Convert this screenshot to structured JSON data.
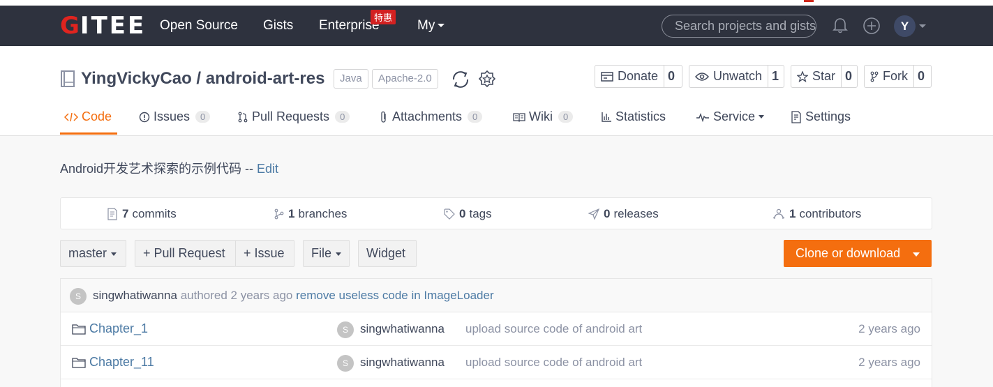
{
  "nav": {
    "logo_g": "G",
    "logo_rest": "ITEE",
    "links": [
      "Open Source",
      "Gists",
      "Enterprise",
      "My"
    ],
    "enterprise_badge": "特惠",
    "search_placeholder": "Search projects and gists",
    "avatar_letter": "Y"
  },
  "repo": {
    "owner_repo": "YingVickyCao / android-art-res",
    "language": "Java",
    "license": "Apache-2.0",
    "actions": {
      "donate": {
        "label": "Donate",
        "count": "0"
      },
      "unwatch": {
        "label": "Unwatch",
        "count": "1"
      },
      "star": {
        "label": "Star",
        "count": "0"
      },
      "fork": {
        "label": "Fork",
        "count": "0"
      }
    }
  },
  "tabs": [
    {
      "label": "Code"
    },
    {
      "label": "Issues",
      "count": "0"
    },
    {
      "label": "Pull Requests",
      "count": "0"
    },
    {
      "label": "Attachments",
      "count": "0"
    },
    {
      "label": "Wiki",
      "count": "0"
    },
    {
      "label": "Statistics"
    },
    {
      "label": "Service"
    },
    {
      "label": "Settings"
    }
  ],
  "description": {
    "text": "Android开发艺术探索的示例代码 -- ",
    "edit": "Edit"
  },
  "stats": {
    "commits": {
      "num": "7",
      "label": "commits"
    },
    "branches": {
      "num": "1",
      "label": "branches"
    },
    "tags": {
      "num": "0",
      "label": "tags"
    },
    "releases": {
      "num": "0",
      "label": "releases"
    },
    "contributors": {
      "num": "1",
      "label": "contributors"
    }
  },
  "toolbar": {
    "branch": "master",
    "pull_request": "+ Pull Request",
    "issue": "+ Issue",
    "file": "File",
    "widget": "Widget",
    "clone": "Clone or download"
  },
  "last_commit": {
    "avatar": "S",
    "author": "singwhatiwanna",
    "authored": "authored 2 years ago",
    "message": "remove useless code in ImageLoader"
  },
  "files": [
    {
      "name": "Chapter_1",
      "avatar": "S",
      "author": "singwhatiwanna",
      "message": "upload source code of android art",
      "time": "2 years ago"
    },
    {
      "name": "Chapter_11",
      "avatar": "S",
      "author": "singwhatiwanna",
      "message": "upload source code of android art",
      "time": "2 years ago"
    }
  ],
  "colors": {
    "navbar": "#2e323e",
    "accent": "#f46e0f",
    "link": "#4c7aa4",
    "logo_red": "#e0241f"
  }
}
